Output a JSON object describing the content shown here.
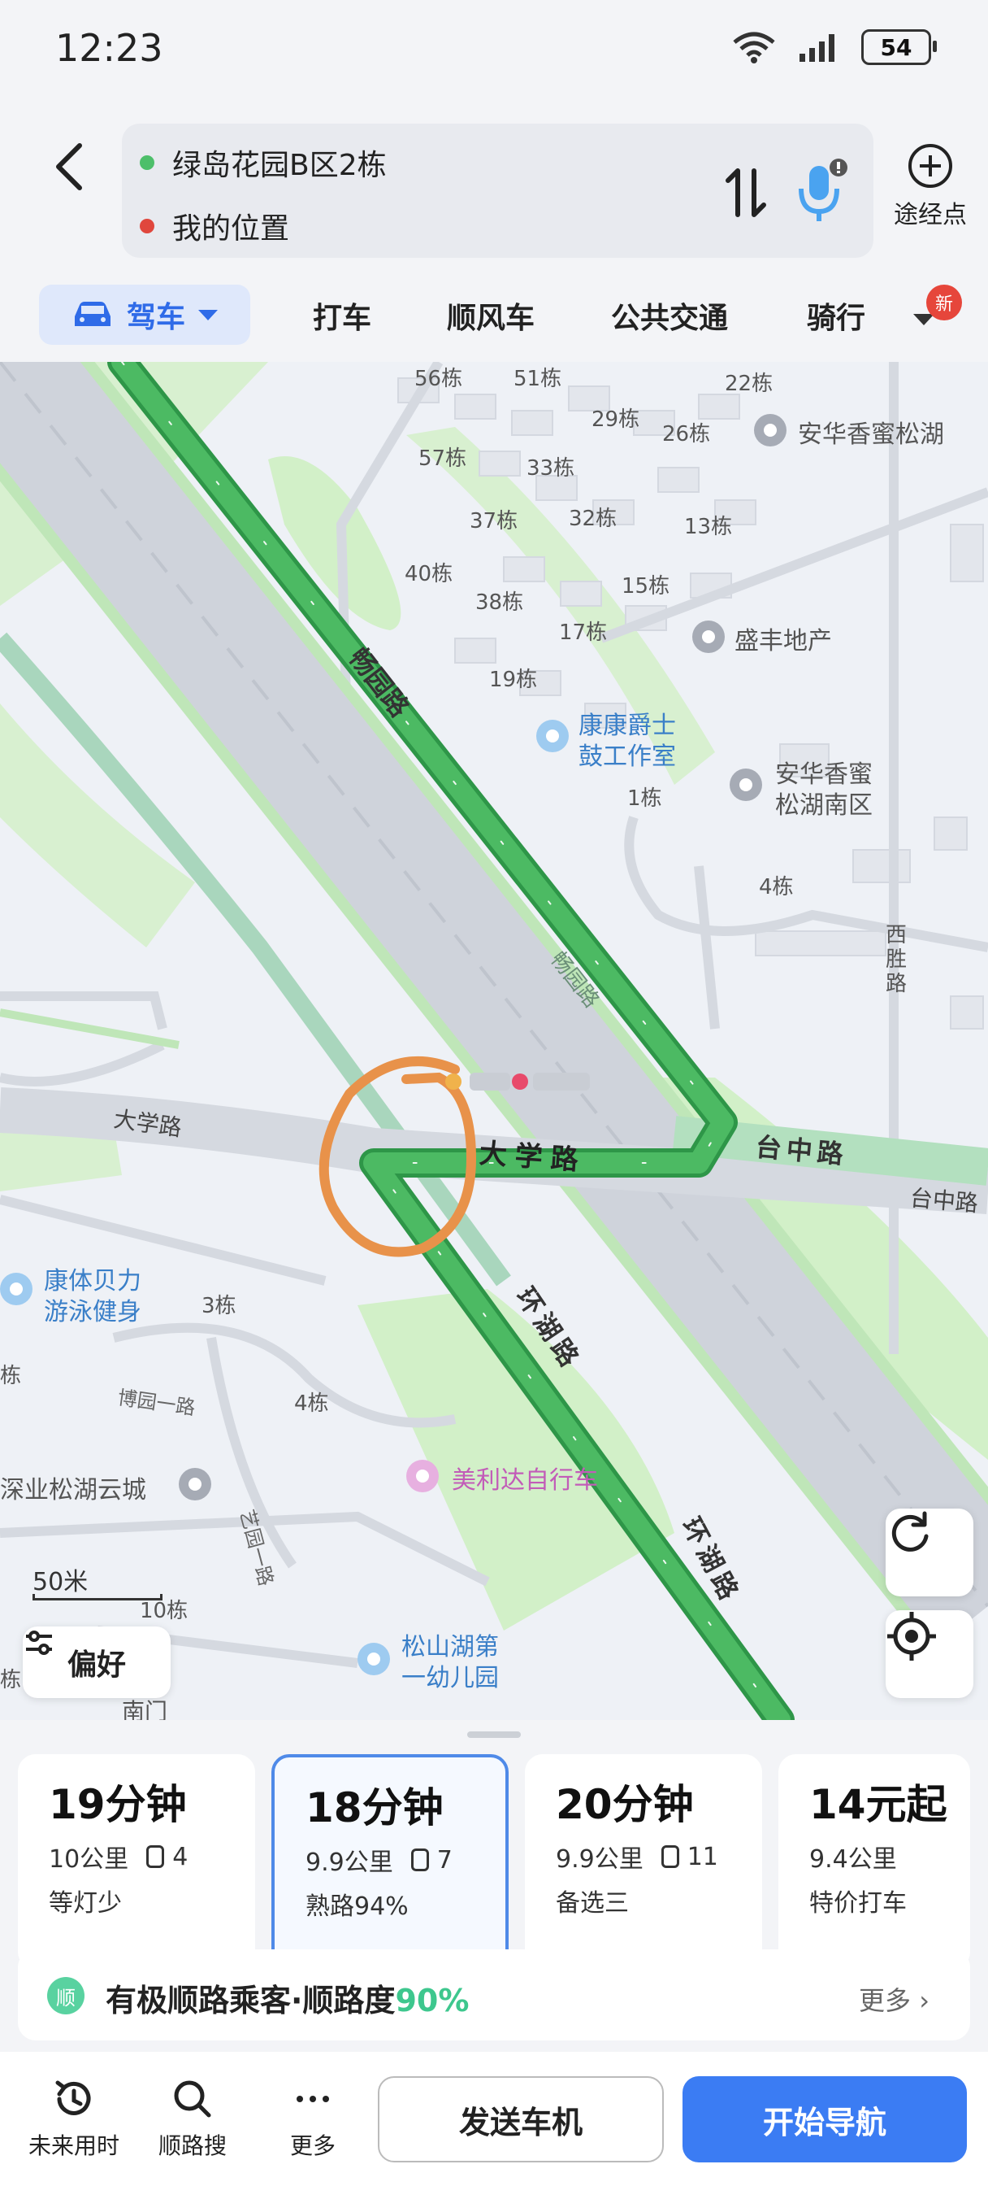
{
  "status_bar": {
    "time": "12:23",
    "battery": "54"
  },
  "header": {
    "origin": "绿岛花园B区2栋",
    "destination": "我的位置",
    "waypoint_label": "途经点",
    "colors": {
      "origin_dot": "#4dbf6a",
      "destination_dot": "#e0473d"
    }
  },
  "tabs": {
    "drive": "驾车",
    "taxi": "打车",
    "carpool": "顺风车",
    "transit": "公共交通",
    "ride": "骑行",
    "new_badge": "新"
  },
  "map": {
    "roads": {
      "changyuan_1": "畅园路",
      "changyuan_2": "畅园路",
      "daxue_main": "大学路",
      "daxue_left": "大学路",
      "taizhong_1": "台中路",
      "taizhong_2": "台中路",
      "huanhu_1": "环湖路",
      "huanhu_2": "环湖路",
      "xisheng": "西胜路",
      "boyuan_1": "博园一路",
      "yiyuan_1": "艺园一路"
    },
    "buildings": [
      "56栋",
      "51栋",
      "22栋",
      "29栋",
      "26栋",
      "57栋",
      "33栋",
      "37栋",
      "32栋",
      "13栋",
      "40栋",
      "15栋",
      "38栋",
      "17栋",
      "19栋",
      "1栋",
      "4栋",
      "3栋",
      "4栋",
      "10栋",
      "栋",
      "栋"
    ],
    "pois": {
      "anhua_songhu": "安华香蜜松湖",
      "shengfeng": "盛丰地产",
      "kangkang_1": "康康爵士",
      "kangkang_2": "鼓工作室",
      "anhua_south_1": "安华香蜜",
      "anhua_south_2": "松湖南区",
      "kangti_1": "康体贝力",
      "kangti_2": "游泳健身",
      "shenye": "深业松湖云城",
      "meilida": "美利达自行车",
      "songshan_1": "松山湖第",
      "songshan_2": "一幼儿园",
      "nanmen": "南门"
    },
    "scale": "50米",
    "preference": "偏好",
    "colors": {
      "route": "#4cba63",
      "route_edge": "#2e9648",
      "annotation": "#e8924a"
    }
  },
  "routes": [
    {
      "time": "19分钟",
      "distance": "10公里",
      "lights": "4",
      "tag": "等灯少",
      "selected": false
    },
    {
      "time": "18分钟",
      "distance": "9.9公里",
      "lights": "7",
      "tag": "熟路94%",
      "selected": true
    },
    {
      "time": "20分钟",
      "distance": "9.9公里",
      "lights": "11",
      "tag": "备选三",
      "selected": false
    },
    {
      "time": "14元起",
      "distance": "9.4公里",
      "lights": "",
      "tag": "特价打车",
      "selected": false
    }
  ],
  "promo": {
    "badge": "顺",
    "text": "有极顺路乘客·顺路度",
    "percent": "90%",
    "more": "更多 ›"
  },
  "actions": {
    "future": "未来用时",
    "along": "顺路搜",
    "more": "更多",
    "send": "发送车机",
    "start": "开始导航"
  }
}
